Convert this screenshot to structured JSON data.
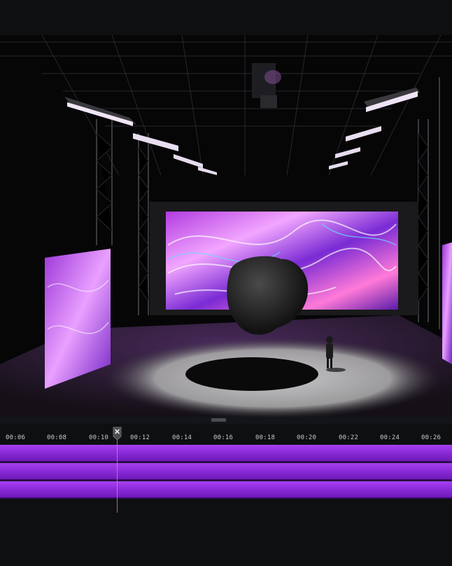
{
  "viewport": {
    "scene": "3d-stage-preview"
  },
  "timeline": {
    "playhead_icon": "close-x-icon",
    "ticks": [
      "00:06",
      "00:08",
      "00:10",
      "00:12",
      "00:14",
      "00:16",
      "00:18",
      "00:20",
      "00:22",
      "00:24",
      "00:26"
    ],
    "tracks": [
      "track-1",
      "track-2",
      "track-3"
    ],
    "track_color": "#9a34e4",
    "playhead_color": "#d87bd0"
  }
}
